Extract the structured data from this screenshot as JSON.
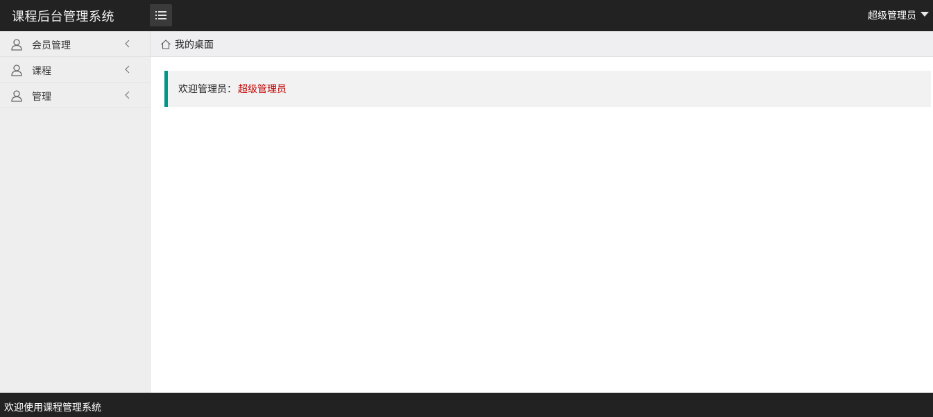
{
  "header": {
    "logo": "课程后台管理系统",
    "menu_toggle_icon": "list-icon",
    "user": "超级管理员"
  },
  "sidebar": {
    "items": [
      {
        "label": "会员管理",
        "icon": "user-icon"
      },
      {
        "label": "课程",
        "icon": "user-icon"
      },
      {
        "label": "管理",
        "icon": "user-icon"
      }
    ]
  },
  "tabs": [
    {
      "label": "我的桌面",
      "icon": "home-icon"
    }
  ],
  "main": {
    "welcome_prefix": "欢迎管理员：",
    "welcome_name": "超级管理员"
  },
  "footer": {
    "text": "欢迎使用课程管理系统"
  },
  "colors": {
    "header_bg": "#222222",
    "accent": "#009688",
    "admin_name": "#c00000",
    "sidebar_bg": "#eeeeee"
  }
}
